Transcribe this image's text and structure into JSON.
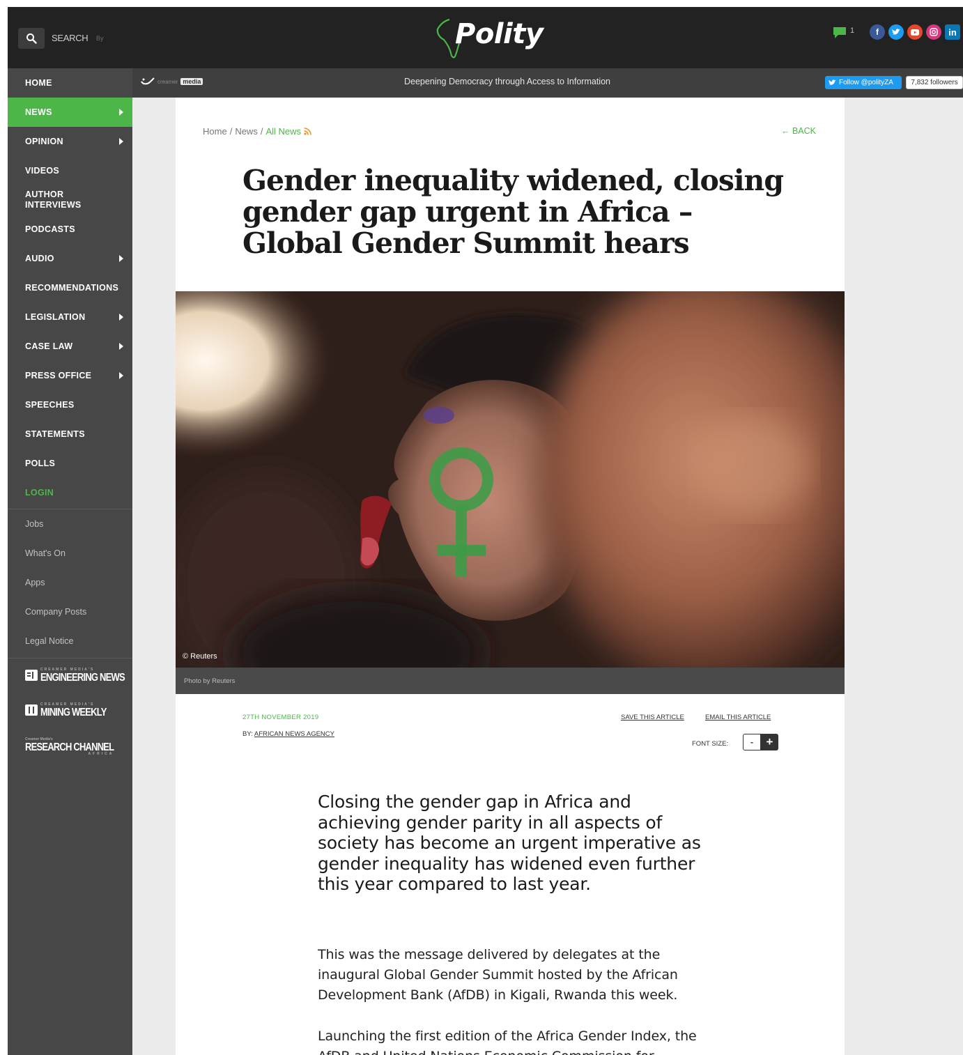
{
  "header": {
    "search_label": "SEARCH",
    "search_by": "By",
    "logo": "Polity",
    "comment_count": "1",
    "social_icons": [
      "facebook-icon",
      "twitter-icon",
      "youtube-icon",
      "instagram-icon",
      "linkedin-icon"
    ]
  },
  "subbar": {
    "creamer_word": "creamer",
    "creamer_media": "media",
    "tagline": "Deepening Democracy through Access to Information",
    "follow_label": "Follow @polityZA",
    "followers": "7,832 followers"
  },
  "sidebar": {
    "items": [
      {
        "label": "HOME"
      },
      {
        "label": "NEWS"
      },
      {
        "label": "OPINION"
      },
      {
        "label": "VIDEOS"
      },
      {
        "label": "AUTHOR INTERVIEWS"
      },
      {
        "label": "PODCASTS"
      },
      {
        "label": "AUDIO"
      },
      {
        "label": "RECOMMENDATIONS"
      },
      {
        "label": "LEGISLATION"
      },
      {
        "label": "CASE LAW"
      },
      {
        "label": "PRESS OFFICE"
      },
      {
        "label": "SPEECHES"
      },
      {
        "label": "STATEMENTS"
      },
      {
        "label": "POLLS"
      },
      {
        "label": "LOGIN"
      }
    ],
    "secondary": [
      {
        "label": "Jobs"
      },
      {
        "label": "What's On"
      },
      {
        "label": "Apps"
      },
      {
        "label": "Company Posts"
      },
      {
        "label": "Legal Notice"
      }
    ],
    "brands": [
      {
        "small": "CREAMER MEDIA'S",
        "big": "ENGINEERING NEWS"
      },
      {
        "small": "CREAMER MEDIA'S",
        "big": "MINING WEEKLY"
      },
      {
        "small": "Creamer Media's",
        "big": "RESEARCH CHANNEL",
        "tail": "AFRICA"
      }
    ]
  },
  "article": {
    "breadcrumb": {
      "home": "Home",
      "sep": "/",
      "news": "News",
      "all_news": "All News"
    },
    "back": "← BACK",
    "headline": "Gender inequality widened, closing gender gap urgent in Africa – Global Gender Summit hears",
    "photo_credit": "© Reuters",
    "caption": "Photo by Reuters",
    "date": "27TH NOVEMBER 2019",
    "by_prefix": "BY:",
    "author": "AFRICAN NEWS AGENCY",
    "save": "SAVE THIS ARTICLE",
    "email": "EMAIL THIS ARTICLE",
    "font_size_label": "FONT SIZE:",
    "font_minus": "-",
    "font_plus": "+",
    "lead": "Closing the gender gap in Africa and achieving gender parity in all aspects of society has become an urgent imperative as gender inequality has widened even further this year compared to last year.",
    "paragraphs": [
      "This was the message delivered by delegates at the inaugural Global Gender Summit hosted by the African Development Bank (AfDB) in Kigali, Rwanda this week.",
      "Launching the first edition of the Africa Gender Index, the AfDB and United Nations Economic Commission for"
    ]
  }
}
